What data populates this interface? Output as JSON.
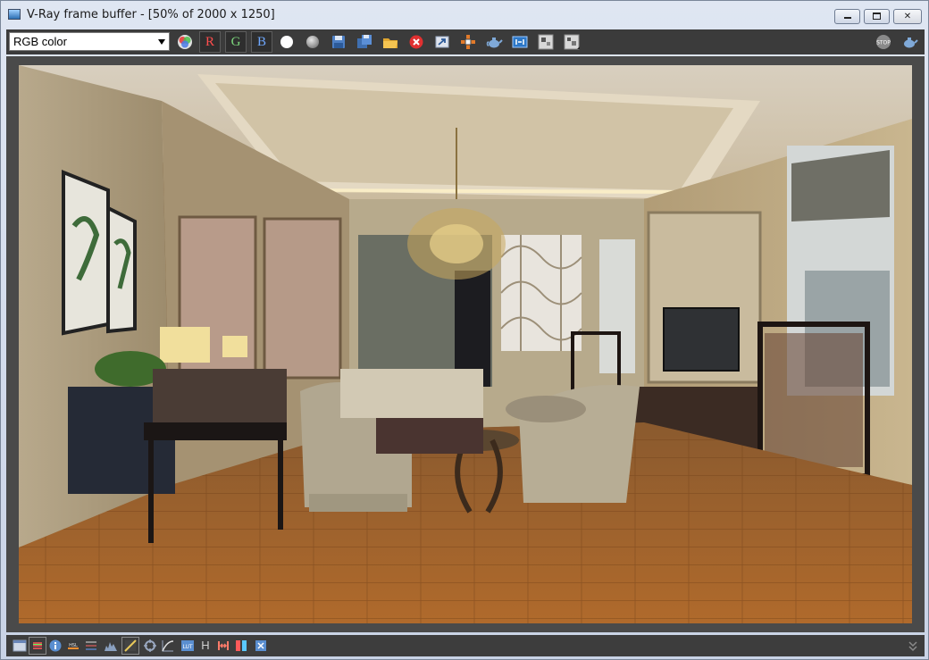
{
  "window": {
    "title": "V-Ray frame buffer - [50% of 2000 x 1250]",
    "controls": {
      "minimize": "minimize",
      "maximize": "maximize",
      "close": "close"
    }
  },
  "toolbar": {
    "channel_value": "RGB color",
    "red_label": "R",
    "green_label": "G",
    "blue_label": "B"
  },
  "statusbar": {
    "h_label": "H"
  },
  "colors": {
    "toolbar_bg": "#3b3b3b",
    "red_channel": "#ff4d4d",
    "green_channel": "#7cd67c",
    "blue_channel": "#6fa8ff",
    "clear_icon": "#e03030"
  }
}
